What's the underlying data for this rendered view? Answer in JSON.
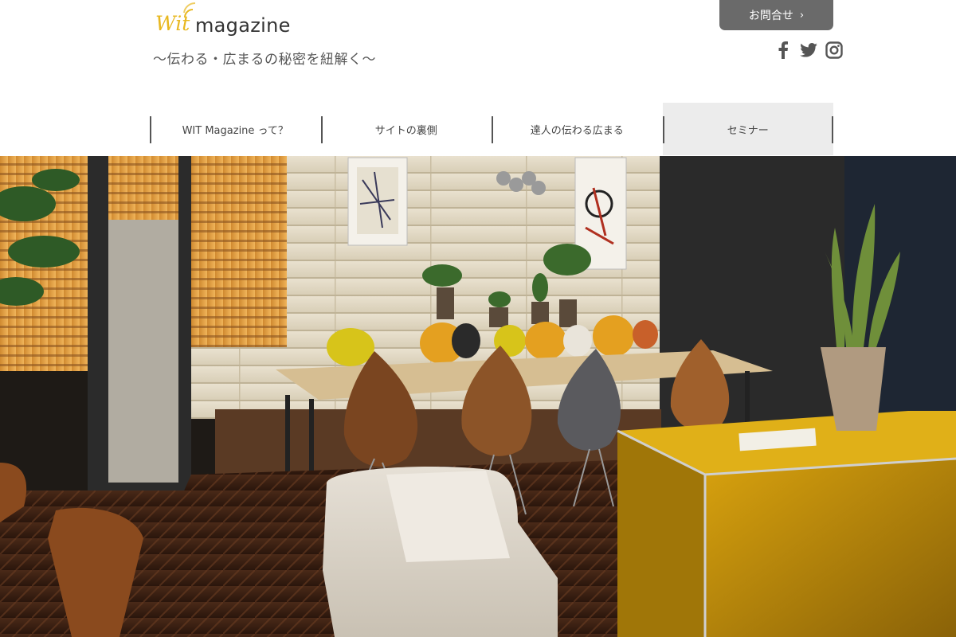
{
  "header": {
    "logo": {
      "wit": "Wit",
      "magazine": "magazine"
    },
    "tagline": "～伝わる・広まるの秘密を紐解く～",
    "contact_label": "お問合せ",
    "contact_chevron": "›",
    "social": [
      {
        "name": "facebook-icon"
      },
      {
        "name": "twitter-icon"
      },
      {
        "name": "instagram-icon"
      }
    ]
  },
  "nav": {
    "items": [
      {
        "label": "WIT Magazine って？"
      },
      {
        "label": "サイトの裏側"
      },
      {
        "label": "達人の伝わる広まる"
      },
      {
        "label": "セミナー",
        "active": true
      }
    ]
  },
  "colors": {
    "accent": "#e8b820",
    "button": "#6a6a6a",
    "nav_active": "#ececec"
  }
}
